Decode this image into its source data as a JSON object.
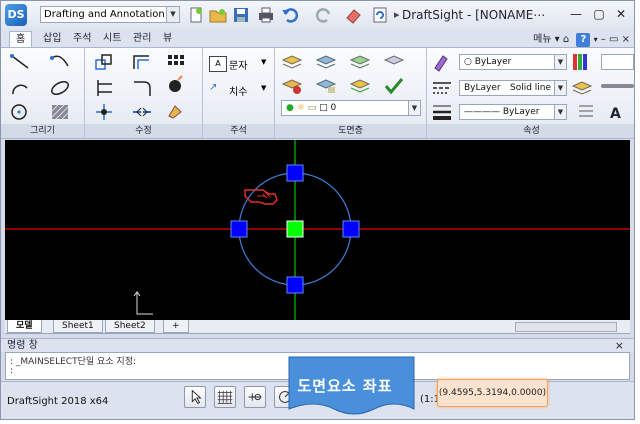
{
  "app": {
    "workspace": "Drafting and Annotation",
    "title": "DraftSight - [NONAME⋯",
    "help_menu": "메뉴 ▾ ⌂",
    "help_icon": "question-icon"
  },
  "ribbon": {
    "tabs": [
      "홈",
      "삽입",
      "주석",
      "시트",
      "관리",
      "뷰"
    ],
    "panels": {
      "draw": "그리기",
      "modify": "수정",
      "annotation": "주석",
      "layers": "도면층",
      "properties": "속성"
    },
    "annotation_buttons": {
      "text": "문자",
      "dimension": "치수"
    },
    "layer_value": "0",
    "properties": {
      "color": "ByLayer",
      "linetype": "ByLayer",
      "linetype_style": "Solid line",
      "lineweight": "———— ByLayer"
    }
  },
  "sheets": {
    "tabs": [
      "모델",
      "Sheet1",
      "Sheet2"
    ],
    "add": "+"
  },
  "command": {
    "header": "명령 창",
    "close": "×",
    "line1": ": _MAINSELECT단일 요소 지정:",
    "line2": ":"
  },
  "status": {
    "app_name": "DraftSight 2018 x64",
    "scale": "(1:1)",
    "coordinates": "(9.4595,5.3194,0.0000)"
  },
  "callout": {
    "text": "도면요소 좌표"
  },
  "colors": {
    "canvas": "#000000",
    "x_axis": "#c00000",
    "y_axis": "#00a000",
    "circle": "#3f7fd8",
    "grip": "#0000ff",
    "grip_center": "#00ff00",
    "callout": "#4a8fd9",
    "coords_highlight": "#fbe3cf"
  }
}
